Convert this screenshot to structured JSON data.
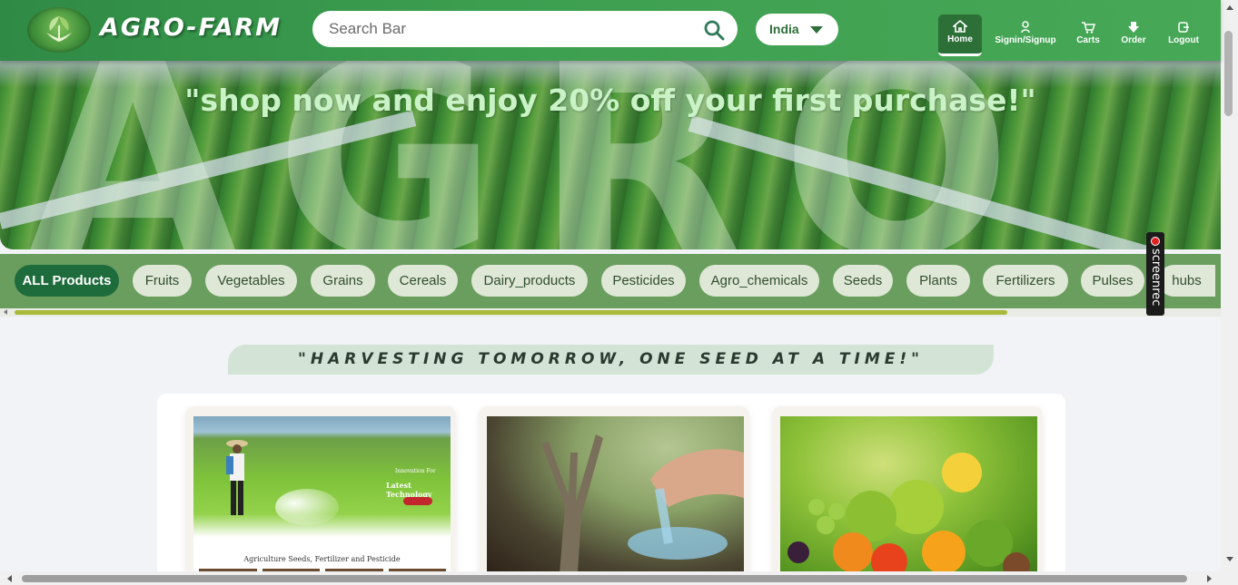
{
  "header": {
    "brand": "AGRO-FARM",
    "search": {
      "placeholder": "Search Bar"
    },
    "country": {
      "selected": "India"
    },
    "nav": [
      {
        "label": "Home",
        "icon": "home-icon",
        "active": true
      },
      {
        "label": "Signin/Signup",
        "icon": "user-icon"
      },
      {
        "label": "Carts",
        "icon": "cart-icon"
      },
      {
        "label": "Order",
        "icon": "order-icon"
      },
      {
        "label": "Logout",
        "icon": "logout-icon"
      }
    ]
  },
  "banner": {
    "watermark": "AGRO",
    "promo": "\"shop now and enjoy 20% off your first purchase!\""
  },
  "categories": [
    {
      "label": "ALL Products",
      "active": true
    },
    {
      "label": "Fruits"
    },
    {
      "label": "Vegetables"
    },
    {
      "label": "Grains"
    },
    {
      "label": "Cereals"
    },
    {
      "label": "Dairy_products"
    },
    {
      "label": "Pesticides"
    },
    {
      "label": "Agro_chemicals"
    },
    {
      "label": "Seeds"
    },
    {
      "label": "Plants"
    },
    {
      "label": "Fertilizers"
    },
    {
      "label": "Pulses"
    },
    {
      "label": "hubs"
    }
  ],
  "tagline": "\"HARVESTING TOMORROW, ONE SEED AT A TIME!\"",
  "cards": [
    {
      "image": "farmer-spraying-field",
      "overlay_small": "Innovation For",
      "overlay_title": "Latest Technology",
      "caption": "Agriculture Seeds, Fertilizer and Pesticide"
    },
    {
      "image": "hand-spreading-fertilizer"
    },
    {
      "image": "fruit-basket"
    }
  ],
  "widget": {
    "label": "screenrec"
  },
  "colors": {
    "header": "#3c9e4f",
    "active_pill": "#1e6b3c",
    "catbar": "#6a9e5f",
    "promo_text": "#c9f2c6"
  }
}
